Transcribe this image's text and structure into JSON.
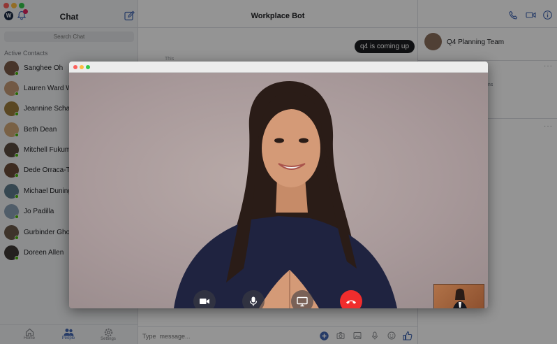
{
  "sidebar": {
    "title": "Chat",
    "logo": "W",
    "search_placeholder": "Search Chat",
    "contacts_label": "Active Contacts",
    "contacts": [
      {
        "name": "Sanghee Oh",
        "color": "#7a5a48"
      },
      {
        "name": "Lauren Ward W",
        "color": "#c49a76"
      },
      {
        "name": "Jeannine Schat",
        "color": "#9c7a3c"
      },
      {
        "name": "Beth Dean",
        "color": "#d1a878"
      },
      {
        "name": "Mitchell Fukum",
        "color": "#5b4a3f"
      },
      {
        "name": "Dede Orraca-Te",
        "color": "#6a4a38"
      },
      {
        "name": "Michael Duning",
        "color": "#5e7a8c"
      },
      {
        "name": "Jo Padilla",
        "color": "#8aa0b5"
      },
      {
        "name": "Gurbinder Ghot",
        "color": "#6b5a4a"
      },
      {
        "name": "Doreen Allen",
        "color": "#3f3a36"
      }
    ],
    "tabs": [
      {
        "label": "Home",
        "icon": "home-icon"
      },
      {
        "label": "People",
        "icon": "people-icon"
      },
      {
        "label": "Settings",
        "icon": "gear-icon"
      }
    ]
  },
  "center": {
    "title": "Workplace Bot",
    "bubble": "q4 is coming up",
    "faded_text": "This",
    "composer_placeholder": "Type  message..."
  },
  "right": {
    "group_name": "Q4 Planning Team",
    "options_text": "ons",
    "dots": "···"
  },
  "call": {
    "controls": [
      "video-toggle",
      "mute",
      "screen-share",
      "end-call"
    ]
  },
  "colors": {
    "accent": "#4267b2",
    "online": "#44b700",
    "end_call": "#f02d2d",
    "bubble": "#1c1e21"
  }
}
